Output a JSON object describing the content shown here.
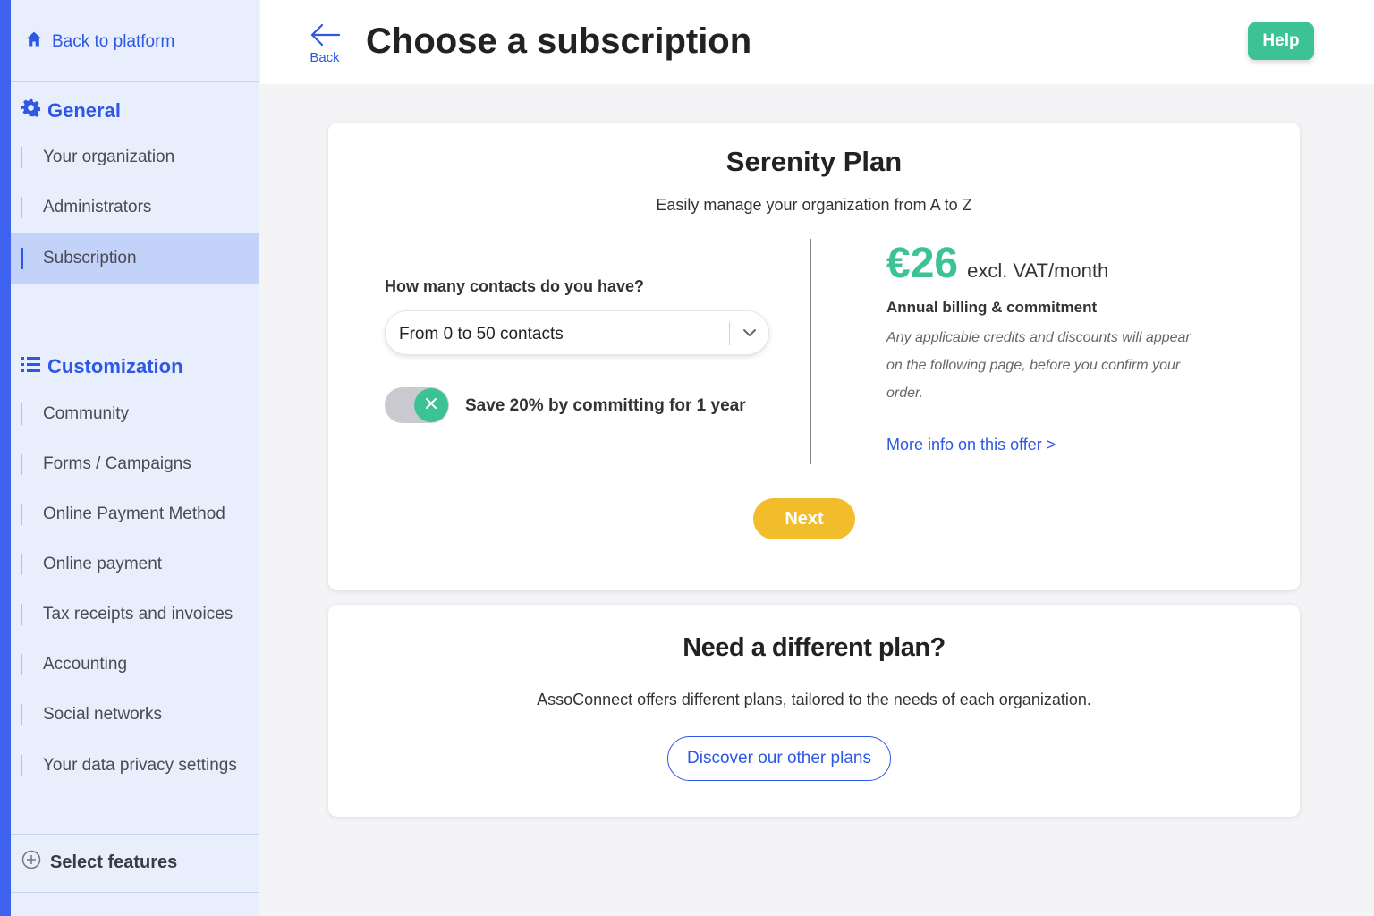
{
  "sidebar": {
    "back_label": "Back to platform",
    "general": {
      "title": "General",
      "items": [
        {
          "label": "Your organization"
        },
        {
          "label": "Administrators"
        },
        {
          "label": "Subscription",
          "active": true
        }
      ]
    },
    "customization": {
      "title": "Customization",
      "items": [
        {
          "label": "Community"
        },
        {
          "label": "Forms / Campaigns"
        },
        {
          "label": "Online Payment Method"
        },
        {
          "label": "Online payment"
        },
        {
          "label": "Tax receipts and invoices"
        },
        {
          "label": "Accounting"
        },
        {
          "label": "Social networks"
        },
        {
          "label": "Your data privacy settings"
        }
      ]
    },
    "select_features": "Select features"
  },
  "header": {
    "back_label": "Back",
    "title": "Choose a subscription",
    "help_label": "Help"
  },
  "plan": {
    "title": "Serenity Plan",
    "subtitle": "Easily manage your organization from A to Z",
    "contacts_question": "How many contacts do you have?",
    "contacts_selected": "From 0 to 50 contacts",
    "commit_toggle_on": true,
    "commit_label": "Save 20% by committing for 1 year",
    "price": "€26",
    "price_unit": "excl. VAT/month",
    "billing": "Annual billing & commitment",
    "note": "Any applicable credits and discounts will appear on the following page, before you confirm your order.",
    "more_info": "More info on this offer >",
    "next_label": "Next"
  },
  "other_plans": {
    "title": "Need a different plan?",
    "text": "AssoConnect offers different plans, tailored to the needs of each organization.",
    "button_label": "Discover our other plans"
  },
  "colors": {
    "brand_blue": "#2d57e6",
    "accent_green": "#3cc295",
    "next_yellow": "#f2bd2b",
    "sidebar_bg": "#e9eefc",
    "active_item_bg": "#c3d2f8"
  }
}
